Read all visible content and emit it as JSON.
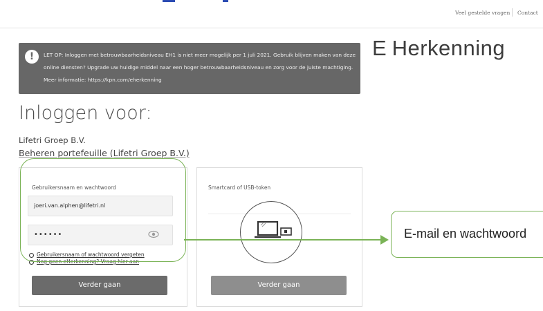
{
  "header": {
    "faq_link": "Veel gestelde vragen",
    "contact_link": "Contact"
  },
  "logo": {
    "text": "E Herkenning"
  },
  "notice": {
    "icon": "exclamation-icon",
    "text": "LET OP: Inloggen met betrouwbaarheidsniveau EH1 is niet meer mogelijk per 1 juli 2021. Gebruik blijven maken van deze online diensten? Upgrade uw huidige middel naar een hoger betrouwbaarheidsniveau en zorg voor de juiste machtiging. Meer informatie: https://kpn.com/eherkenning"
  },
  "page": {
    "title": "Inloggen voor:",
    "organisation": "Lifetri Groep B.V.",
    "role": "Beheren portefeuille (Lifetri Groep B.V.)"
  },
  "password_card": {
    "title": "Gebruikersnaam en wachtwoord",
    "email_value": "joeri.van.alphen@lifetri.nl",
    "password_value": "••••••",
    "link_forgot": "Gebruikersnaam of wachtwoord vergeten",
    "link_register": "Nog geen eHerkenning? Vraag hier aan",
    "button_label": "Verder gaan"
  },
  "token_card": {
    "title": "Smartcard of USB-token",
    "icon": "laptop-smartcard-icon",
    "button_label": "Verder gaan"
  },
  "callout": {
    "text": "E-mail en wachtwoord",
    "color": "#7ab356"
  }
}
